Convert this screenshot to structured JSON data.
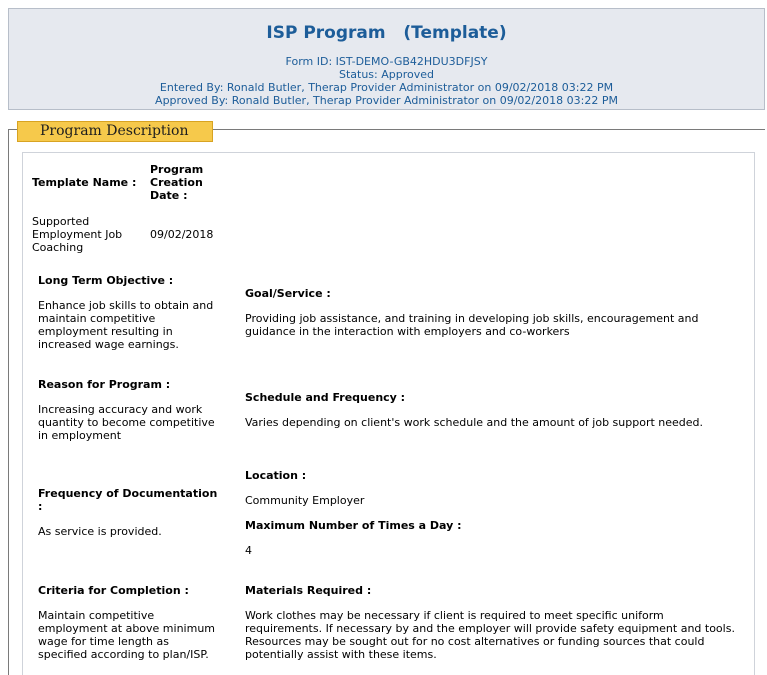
{
  "header": {
    "title_main": "ISP Program",
    "title_sub": "(Template)",
    "form_id": "Form ID: IST-DEMO-GB42HDU3DFJSY",
    "status": "Status: Approved",
    "entered_by": "Entered By: Ronald Butler, Therap Provider Administrator  on 09/02/2018 03:22 PM",
    "approved_by": "Approved By: Ronald Butler, Therap Provider Administrator  on 09/02/2018 03:22 PM"
  },
  "section": {
    "legend": "Program Description"
  },
  "fields": {
    "template_name_label": "Template Name :",
    "template_name_value": [
      "Supported",
      "Employment Job",
      "Coaching"
    ],
    "creation_date_label": [
      "Program",
      "Creation",
      "Date :"
    ],
    "creation_date_value": "09/02/2018",
    "long_term_objective_label": "Long Term Objective :",
    "long_term_objective_value": [
      "Enhance job skills to obtain and",
      "maintain competitive",
      "employment resulting in",
      "increased wage earnings."
    ],
    "goal_service_label": "Goal/Service :",
    "goal_service_value": [
      "Providing job assistance, and training in developing job skills, encouragement and",
      "guidance in the interaction with employers and co-workers"
    ],
    "reason_label": "Reason for Program :",
    "reason_value": [
      "Increasing accuracy and work",
      "quantity to become competitive",
      "in employment"
    ],
    "schedule_label": "Schedule and Frequency :",
    "schedule_value": "Varies depending on client's work schedule and the amount of job support needed.",
    "location_label": "Location :",
    "location_value": "Community Employer",
    "freq_doc_label": [
      "Frequency of Documentation",
      ":"
    ],
    "freq_doc_value": "As service is provided.",
    "max_times_label": "Maximum Number of Times a Day :",
    "max_times_value": "4",
    "criteria_label": "Criteria for Completion :",
    "criteria_value": [
      "Maintain competitive",
      "employment at above minimum",
      "wage for time length as",
      "specified according to plan/ISP."
    ],
    "materials_label": "Materials Required :",
    "materials_value": [
      "Work clothes may be necessary if client is required to meet specific uniform",
      "requirements. If necessary by and the employer will provide safety equipment and tools.",
      "Resources may be sought out for no cost alternatives or funding sources that could",
      "potentially assist with these items."
    ]
  }
}
